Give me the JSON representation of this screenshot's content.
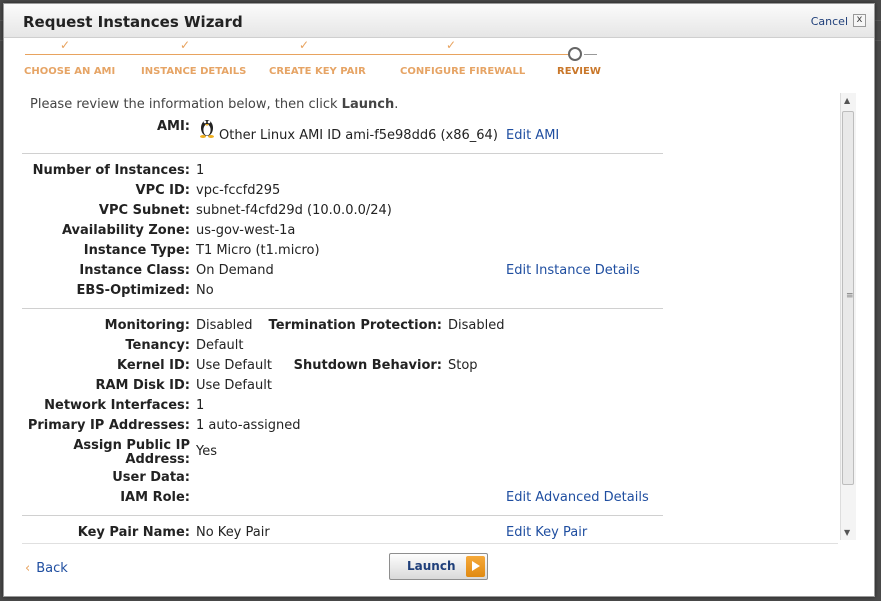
{
  "window": {
    "title": "Request Instances Wizard",
    "cancel_label": "Cancel",
    "close_glyph": "x"
  },
  "steps": [
    {
      "label": "CHOOSE AN AMI",
      "completed": true
    },
    {
      "label": "INSTANCE DETAILS",
      "completed": true
    },
    {
      "label": "CREATE KEY PAIR",
      "completed": true
    },
    {
      "label": "CONFIGURE FIREWALL",
      "completed": true
    },
    {
      "label": "REVIEW",
      "completed": false,
      "current": true
    }
  ],
  "icons": {
    "step_done": "checkmark-icon",
    "ami": "linux-penguin-icon",
    "back": "chevron-left-icon",
    "launch": "play-arrow-icon"
  },
  "colors": {
    "wizard_accent": "#e8a35f",
    "link": "#1f4ea0",
    "launch_icon": "#f0a030"
  },
  "review": {
    "intro_prefix": "Please review the information below, then click ",
    "intro_bold": "Launch",
    "intro_suffix": ".",
    "ami": {
      "label": "AMI:",
      "value": "Other Linux AMI ID ami-f5e98dd6 (x86_64)",
      "edit": "Edit AMI"
    },
    "instance": {
      "number_label": "Number of Instances:",
      "number_value": "1",
      "vpc_label": "VPC ID:",
      "vpc_value": "vpc-fccfd295",
      "subnet_label": "VPC Subnet:",
      "subnet_value": "subnet-f4cfd29d (10.0.0.0/24)",
      "zone_label": "Availability Zone:",
      "zone_value": "us-gov-west-1a",
      "type_label": "Instance Type:",
      "type_value": "T1 Micro (t1.micro)",
      "class_label": "Instance Class:",
      "class_value": "On Demand",
      "ebs_label": "EBS-Optimized:",
      "ebs_value": "No",
      "edit": "Edit Instance Details"
    },
    "advanced": {
      "monitoring_label": "Monitoring:",
      "monitoring_value": "Disabled",
      "termination_label": "Termination Protection:",
      "termination_value": "Disabled",
      "tenancy_label": "Tenancy:",
      "tenancy_value": "Default",
      "kernel_label": "Kernel ID:",
      "kernel_value": "Use Default",
      "shutdown_label": "Shutdown Behavior:",
      "shutdown_value": "Stop",
      "ramdisk_label": "RAM Disk ID:",
      "ramdisk_value": "Use Default",
      "netif_label": "Network Interfaces:",
      "netif_value": "1",
      "primary_ip_label": "Primary IP Addresses:",
      "primary_ip_value": "1 auto-assigned",
      "public_ip_label_line1": "Assign Public IP",
      "public_ip_label_line2": "Address:",
      "public_ip_value": "Yes",
      "user_data_label": "User Data:",
      "iam_label": "IAM Role:",
      "edit": "Edit Advanced Details"
    },
    "keypair": {
      "label": "Key Pair Name:",
      "value": "No Key Pair",
      "edit": "Edit Key Pair"
    }
  },
  "footer": {
    "back_label": "Back",
    "launch_label": "Launch"
  }
}
